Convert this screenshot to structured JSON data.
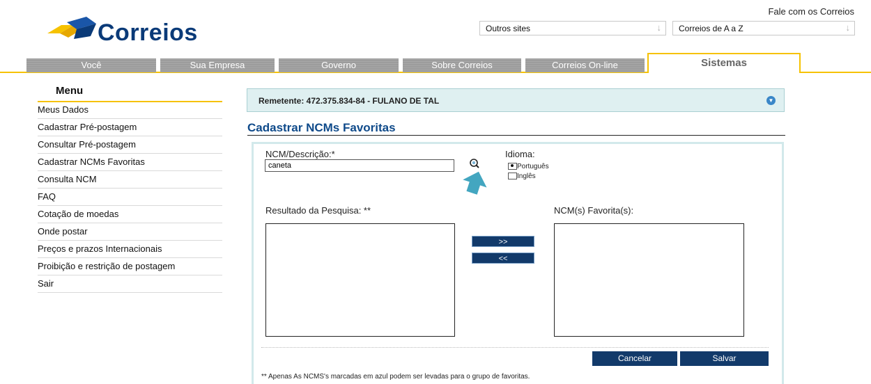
{
  "brand": {
    "logo_text": "Correios",
    "colors": {
      "blue": "#0a3a78",
      "yellow": "#f6c200",
      "navy": "#123a6a"
    }
  },
  "header": {
    "fale_link": "Fale com os Correios",
    "outros_sites": "Outros sites",
    "correios_az": "Correios de A a Z"
  },
  "nav": {
    "tabs": [
      "Você",
      "Sua Empresa",
      "Governo",
      "Sobre Correios",
      "Correios On-line"
    ],
    "active_tab": "Sistemas"
  },
  "menu": {
    "title": "Menu",
    "items": [
      "Meus Dados",
      "Cadastrar Pré-postagem",
      "Consultar Pré-postagem",
      "Cadastrar NCMs Favoritas",
      "Consulta NCM",
      "FAQ",
      "Cotação de moedas",
      "Onde postar",
      "Preços e prazos Internacionais",
      "Proibição e restrição de postagem",
      "Sair"
    ]
  },
  "remetente": "Remetente: 472.375.834-84 - FULANO DE TAL",
  "page": {
    "title": "Cadastrar NCMs Favoritas",
    "ncm_label": "NCM/Descrição:*",
    "ncm_value": "caneta",
    "idioma_label": "Idioma:",
    "idioma_options": [
      "Português",
      "Inglês"
    ],
    "idioma_selected": "Português",
    "result_label": "Resultado da Pesquisa: **",
    "fav_label": "NCM(s) Favorita(s):",
    "add_button": ">>",
    "remove_button": "<<",
    "cancel_button": "Cancelar",
    "save_button": "Salvar",
    "note": "** Apenas As NCMS's marcadas em azul podem ser levadas para o grupo de favoritas."
  }
}
